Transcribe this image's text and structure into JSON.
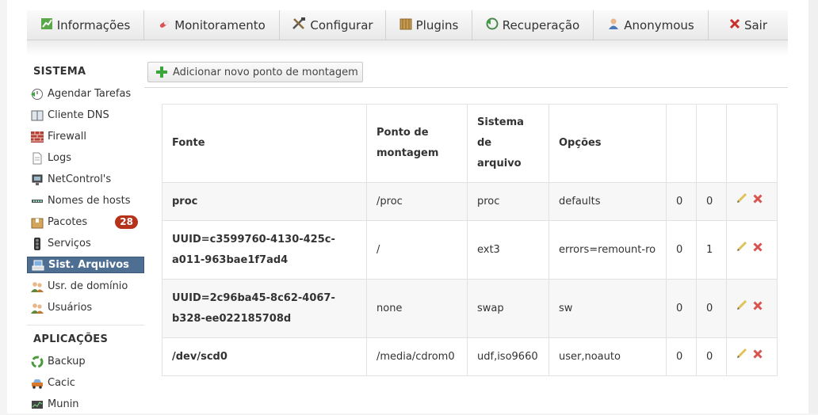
{
  "nav": {
    "items": [
      {
        "label": "Informações",
        "icon": "chart-icon"
      },
      {
        "label": "Monitoramento",
        "icon": "pill-icon"
      },
      {
        "label": "Configurar",
        "icon": "tools-icon"
      },
      {
        "label": "Plugins",
        "icon": "box-icon"
      },
      {
        "label": "Recuperação",
        "icon": "restore-icon"
      },
      {
        "label": "Anonymous",
        "icon": "user-icon"
      },
      {
        "label": "Sair",
        "icon": "close-icon"
      }
    ]
  },
  "sidebar": {
    "sections": [
      {
        "title": "SISTEMA",
        "items": [
          {
            "label": "Agendar Tarefas",
            "icon": "clock-icon"
          },
          {
            "label": "Cliente DNS",
            "icon": "book-icon"
          },
          {
            "label": "Firewall",
            "icon": "brick-wall-icon"
          },
          {
            "label": "Logs",
            "icon": "document-icon"
          },
          {
            "label": "NetControl's",
            "icon": "monitor-icon"
          },
          {
            "label": "Nomes de hosts",
            "icon": "network-icon"
          },
          {
            "label": "Pacotes",
            "icon": "package-icon",
            "badge": "28"
          },
          {
            "label": "Serviços",
            "icon": "traffic-light-icon"
          },
          {
            "label": "Sist. Arquivos",
            "icon": "drive-icon",
            "active": true
          },
          {
            "label": "Usr. de domínio",
            "icon": "users-icon"
          },
          {
            "label": "Usuários",
            "icon": "users-icon"
          }
        ]
      },
      {
        "title": "APLICAÇÕES",
        "items": [
          {
            "label": "Backup",
            "icon": "recycle-icon"
          },
          {
            "label": "Cacic",
            "icon": "car-icon"
          },
          {
            "label": "Munin",
            "icon": "graph-icon"
          }
        ]
      }
    ]
  },
  "main": {
    "add_button": "Adicionar novo ponto de montagem",
    "columns": [
      {
        "lines": [
          "Fonte"
        ]
      },
      {
        "lines": [
          "Ponto de",
          "montagem"
        ]
      },
      {
        "lines": [
          "Sistema",
          "de",
          "arquivo"
        ]
      },
      {
        "lines": [
          "Opções"
        ]
      },
      {
        "lines": [
          ""
        ]
      },
      {
        "lines": [
          ""
        ]
      },
      {
        "lines": [
          ""
        ]
      }
    ],
    "rows": [
      {
        "source": [
          "proc"
        ],
        "mount": "/proc",
        "fs": "proc",
        "options": "defaults",
        "dump": "0",
        "pass": "0"
      },
      {
        "source": [
          "UUID=c3599760-4130-425c-",
          "a011-963bae1f7ad4"
        ],
        "mount": "/",
        "fs": "ext3",
        "options": "errors=remount-ro",
        "dump": "0",
        "pass": "1"
      },
      {
        "source": [
          "UUID=2c96ba45-8c62-4067-",
          "b328-ee022185708d"
        ],
        "mount": "none",
        "fs": "swap",
        "options": "sw",
        "dump": "0",
        "pass": "0"
      },
      {
        "source": [
          "/dev/scd0"
        ],
        "mount": "/media/cdrom0",
        "fs": "udf,iso9660",
        "options": "user,noauto",
        "dump": "0",
        "pass": "0"
      }
    ]
  },
  "colors": {
    "active_bg": "#4f6f92",
    "badge_bg": "#b5331b",
    "delete_red": "#d9534f",
    "add_green": "#3aa53a"
  }
}
